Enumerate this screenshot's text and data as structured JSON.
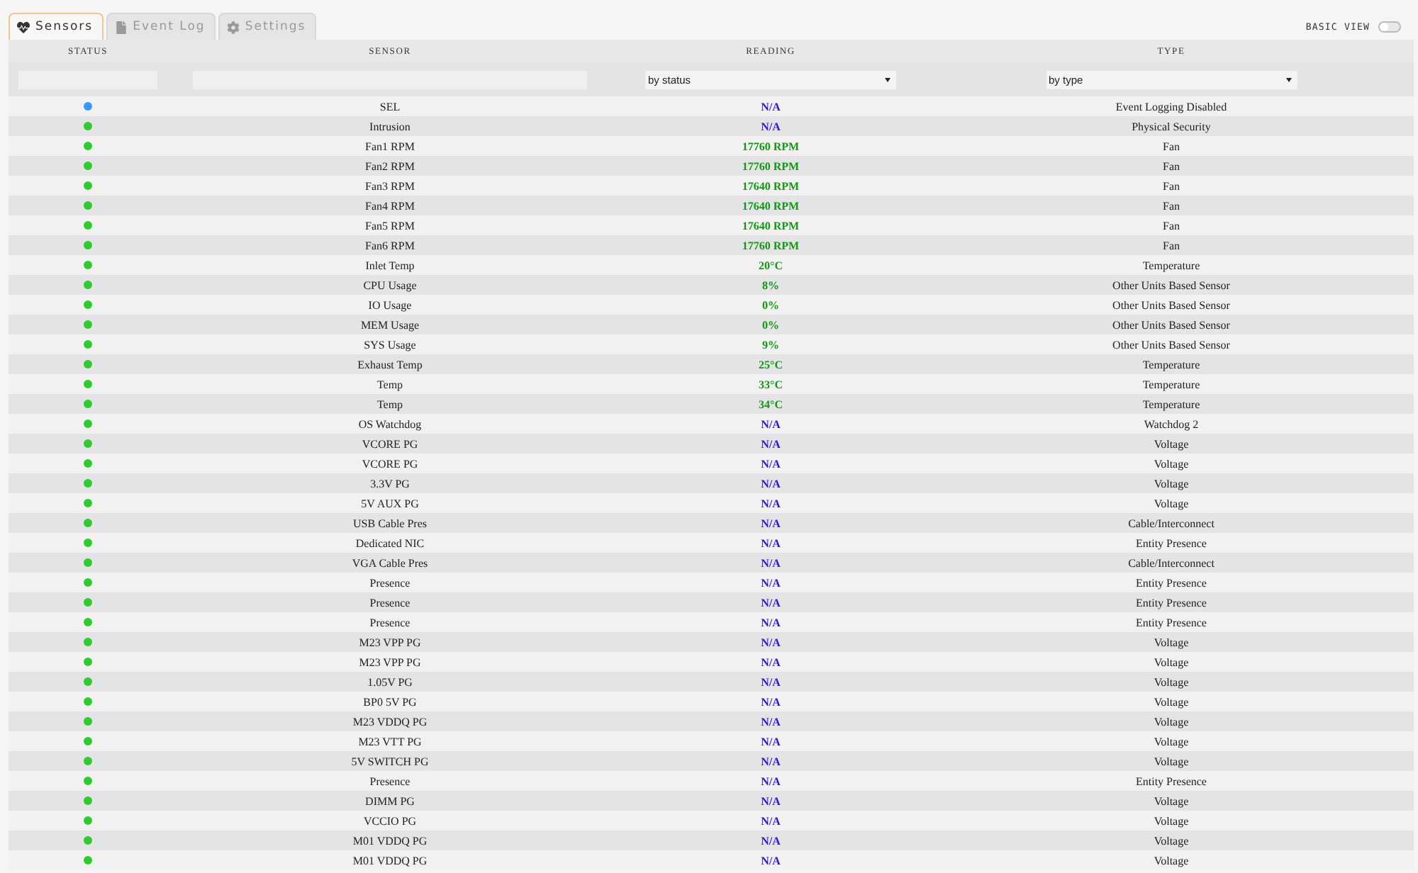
{
  "tabs": [
    {
      "label": "Sensors",
      "selected": true
    },
    {
      "label": "Event Log",
      "selected": false
    },
    {
      "label": "Settings",
      "selected": false
    }
  ],
  "basic_view": {
    "label": "BASIC VIEW",
    "on": false
  },
  "table": {
    "columns": [
      "STATUS",
      "SENSOR",
      "READING",
      "TYPE"
    ],
    "filters": [
      {
        "kind": "input"
      },
      {
        "kind": "input"
      },
      {
        "kind": "select",
        "value": "by status"
      },
      {
        "kind": "select",
        "value": "by type"
      }
    ],
    "rows": [
      {
        "color": "#3399ff",
        "sensor": "SEL",
        "reading": {
          "text": "N/A",
          "kind": "unavailable"
        },
        "type": "Event Logging Disabled"
      },
      {
        "color": "#2ecc2e",
        "sensor": "Intrusion",
        "reading": {
          "text": "N/A",
          "kind": "unavailable"
        },
        "type": "Physical Security"
      },
      {
        "color": "#2ecc2e",
        "sensor": "Fan1 RPM",
        "reading": {
          "text": "17760 RPM",
          "kind": "value"
        },
        "type": "Fan"
      },
      {
        "color": "#2ecc2e",
        "sensor": "Fan2 RPM",
        "reading": {
          "text": "17760 RPM",
          "kind": "value"
        },
        "type": "Fan"
      },
      {
        "color": "#2ecc2e",
        "sensor": "Fan3 RPM",
        "reading": {
          "text": "17640 RPM",
          "kind": "value"
        },
        "type": "Fan"
      },
      {
        "color": "#2ecc2e",
        "sensor": "Fan4 RPM",
        "reading": {
          "text": "17640 RPM",
          "kind": "value"
        },
        "type": "Fan"
      },
      {
        "color": "#2ecc2e",
        "sensor": "Fan5 RPM",
        "reading": {
          "text": "17640 RPM",
          "kind": "value"
        },
        "type": "Fan"
      },
      {
        "color": "#2ecc2e",
        "sensor": "Fan6 RPM",
        "reading": {
          "text": "17760 RPM",
          "kind": "value"
        },
        "type": "Fan"
      },
      {
        "color": "#2ecc2e",
        "sensor": "Inlet Temp",
        "reading": {
          "text": "20°C",
          "kind": "value"
        },
        "type": "Temperature"
      },
      {
        "color": "#2ecc2e",
        "sensor": "CPU Usage",
        "reading": {
          "text": "8%",
          "kind": "value"
        },
        "type": "Other Units Based Sensor"
      },
      {
        "color": "#2ecc2e",
        "sensor": "IO Usage",
        "reading": {
          "text": "0%",
          "kind": "value"
        },
        "type": "Other Units Based Sensor"
      },
      {
        "color": "#2ecc2e",
        "sensor": "MEM Usage",
        "reading": {
          "text": "0%",
          "kind": "value"
        },
        "type": "Other Units Based Sensor"
      },
      {
        "color": "#2ecc2e",
        "sensor": "SYS Usage",
        "reading": {
          "text": "9%",
          "kind": "value"
        },
        "type": "Other Units Based Sensor"
      },
      {
        "color": "#2ecc2e",
        "sensor": "Exhaust Temp",
        "reading": {
          "text": "25°C",
          "kind": "value"
        },
        "type": "Temperature"
      },
      {
        "color": "#2ecc2e",
        "sensor": "Temp",
        "reading": {
          "text": "33°C",
          "kind": "value"
        },
        "type": "Temperature"
      },
      {
        "color": "#2ecc2e",
        "sensor": "Temp",
        "reading": {
          "text": "34°C",
          "kind": "value"
        },
        "type": "Temperature"
      },
      {
        "color": "#2ecc2e",
        "sensor": "OS Watchdog",
        "reading": {
          "text": "N/A",
          "kind": "unavailable"
        },
        "type": "Watchdog 2"
      },
      {
        "color": "#2ecc2e",
        "sensor": "VCORE PG",
        "reading": {
          "text": "N/A",
          "kind": "unavailable"
        },
        "type": "Voltage"
      },
      {
        "color": "#2ecc2e",
        "sensor": "VCORE PG",
        "reading": {
          "text": "N/A",
          "kind": "unavailable"
        },
        "type": "Voltage"
      },
      {
        "color": "#2ecc2e",
        "sensor": "3.3V PG",
        "reading": {
          "text": "N/A",
          "kind": "unavailable"
        },
        "type": "Voltage"
      },
      {
        "color": "#2ecc2e",
        "sensor": "5V AUX PG",
        "reading": {
          "text": "N/A",
          "kind": "unavailable"
        },
        "type": "Voltage"
      },
      {
        "color": "#2ecc2e",
        "sensor": "USB Cable Pres",
        "reading": {
          "text": "N/A",
          "kind": "unavailable"
        },
        "type": "Cable/Interconnect"
      },
      {
        "color": "#2ecc2e",
        "sensor": "Dedicated NIC",
        "reading": {
          "text": "N/A",
          "kind": "unavailable"
        },
        "type": "Entity Presence"
      },
      {
        "color": "#2ecc2e",
        "sensor": "VGA Cable Pres",
        "reading": {
          "text": "N/A",
          "kind": "unavailable"
        },
        "type": "Cable/Interconnect"
      },
      {
        "color": "#2ecc2e",
        "sensor": "Presence",
        "reading": {
          "text": "N/A",
          "kind": "unavailable"
        },
        "type": "Entity Presence"
      },
      {
        "color": "#2ecc2e",
        "sensor": "Presence",
        "reading": {
          "text": "N/A",
          "kind": "unavailable"
        },
        "type": "Entity Presence"
      },
      {
        "color": "#2ecc2e",
        "sensor": "Presence",
        "reading": {
          "text": "N/A",
          "kind": "unavailable"
        },
        "type": "Entity Presence"
      },
      {
        "color": "#2ecc2e",
        "sensor": "M23 VPP PG",
        "reading": {
          "text": "N/A",
          "kind": "unavailable"
        },
        "type": "Voltage"
      },
      {
        "color": "#2ecc2e",
        "sensor": "M23 VPP PG",
        "reading": {
          "text": "N/A",
          "kind": "unavailable"
        },
        "type": "Voltage"
      },
      {
        "color": "#2ecc2e",
        "sensor": "1.05V PG",
        "reading": {
          "text": "N/A",
          "kind": "unavailable"
        },
        "type": "Voltage"
      },
      {
        "color": "#2ecc2e",
        "sensor": "BP0 5V PG",
        "reading": {
          "text": "N/A",
          "kind": "unavailable"
        },
        "type": "Voltage"
      },
      {
        "color": "#2ecc2e",
        "sensor": "M23 VDDQ PG",
        "reading": {
          "text": "N/A",
          "kind": "unavailable"
        },
        "type": "Voltage"
      },
      {
        "color": "#2ecc2e",
        "sensor": "M23 VTT PG",
        "reading": {
          "text": "N/A",
          "kind": "unavailable"
        },
        "type": "Voltage"
      },
      {
        "color": "#2ecc2e",
        "sensor": "5V SWITCH PG",
        "reading": {
          "text": "N/A",
          "kind": "unavailable"
        },
        "type": "Voltage"
      },
      {
        "color": "#2ecc2e",
        "sensor": "Presence",
        "reading": {
          "text": "N/A",
          "kind": "unavailable"
        },
        "type": "Entity Presence"
      },
      {
        "color": "#2ecc2e",
        "sensor": "DIMM PG",
        "reading": {
          "text": "N/A",
          "kind": "unavailable"
        },
        "type": "Voltage"
      },
      {
        "color": "#2ecc2e",
        "sensor": "VCCIO PG",
        "reading": {
          "text": "N/A",
          "kind": "unavailable"
        },
        "type": "Voltage"
      },
      {
        "color": "#2ecc2e",
        "sensor": "M01 VDDQ PG",
        "reading": {
          "text": "N/A",
          "kind": "unavailable"
        },
        "type": "Voltage"
      },
      {
        "color": "#2ecc2e",
        "sensor": "M01 VDDQ PG",
        "reading": {
          "text": "N/A",
          "kind": "unavailable"
        },
        "type": "Voltage"
      }
    ]
  }
}
